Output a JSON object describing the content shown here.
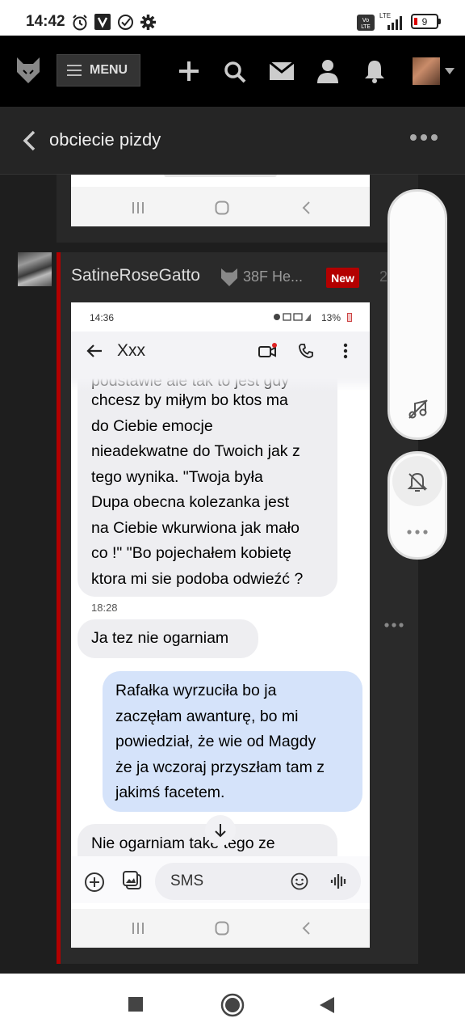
{
  "status_bar": {
    "time": "14:42",
    "network_top": "LTE",
    "battery": "9"
  },
  "nav": {
    "menu_label": "MENU"
  },
  "thread": {
    "title": "obciecie pizdy"
  },
  "post": {
    "author": "SatineRoseGatto",
    "meta": "38F He...",
    "badge": "New",
    "number_partial": "2"
  },
  "embedded_screenshot": {
    "status_time": "14:36",
    "battery": "13%",
    "contact": "Xxx",
    "partial_top_line": "podstawie ale tak to jest gdy",
    "incoming_message_lines": [
      "chcesz by miłym bo ktos ma",
      "do Ciebie emocje",
      "nieadekwatne do Twoich jak z",
      "tego wynika. \"Twoja była",
      "Dupa obecna kolezanka jest",
      "na Ciebie wkurwiona jak mało",
      "co !\" \"Bo pojechałem kobietę",
      "ktora mi sie podoba odwieźć ?"
    ],
    "timestamp": "18:28",
    "incoming_short": "Ja tez nie ogarniam",
    "outgoing_message_lines": [
      "Rafałka wyrzuciła bo ja",
      "zaczęłam awanturę, bo mi",
      "powiedział, że wie od Magdy",
      "że ja wczoraj przyszłam tam z",
      "jakimś facetem."
    ],
    "incoming_partial": "Nie ogarniam tak",
    "incoming_partial_rest": "e tego ze",
    "input_placeholder": "SMS"
  },
  "colors": {
    "accent_red": "#b30000",
    "nav_bg": "#000000",
    "header_bg": "#252525",
    "outgoing_bubble": "#d5e3fa",
    "incoming_bubble": "#eeeef1"
  },
  "icons": [
    "alarm-icon",
    "v-app-icon",
    "check-circle-icon",
    "gear-icon",
    "volte-icon",
    "signal-icon",
    "battery-icon",
    "fox-logo-icon",
    "hamburger-icon",
    "plus-icon",
    "search-icon",
    "mail-icon",
    "user-icon",
    "bell-icon",
    "chevron-left-icon",
    "more-dots-icon",
    "music-off-icon",
    "bell-off-icon"
  ]
}
